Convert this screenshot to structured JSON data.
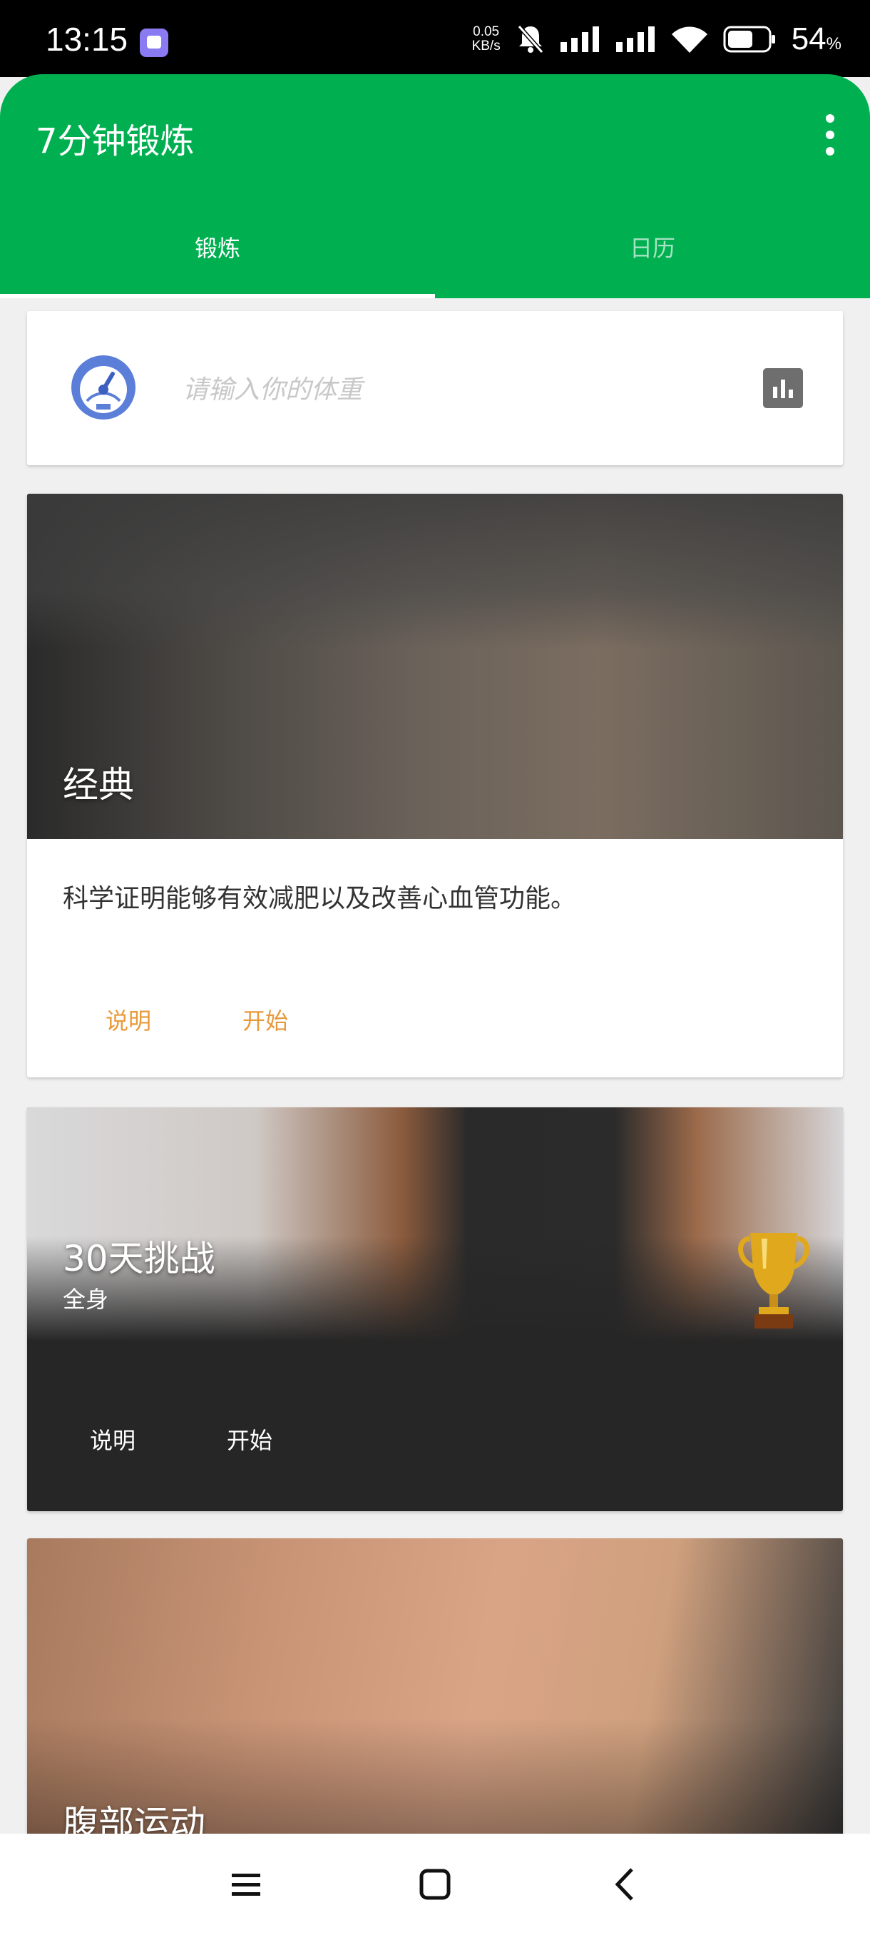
{
  "status_bar": {
    "time": "13:15",
    "net_speed_value": "0.05",
    "net_speed_unit": "KB/s",
    "battery_percent": "54",
    "battery_unit": "%",
    "icons": [
      "app-notification-icon",
      "mute-icon",
      "signal-icon",
      "signal-icon",
      "wifi-icon",
      "battery-icon"
    ]
  },
  "app_bar": {
    "title": "7分钟锻炼",
    "menu_icon": "overflow-menu-icon",
    "background_color": "#00b050"
  },
  "tabs": [
    {
      "label": "锻炼",
      "selected": true
    },
    {
      "label": "日历",
      "selected": false
    }
  ],
  "weight_card": {
    "icon": "gauge-icon",
    "input_placeholder": "请输入你的体重",
    "input_value": "",
    "stats_icon": "bar-chart-icon"
  },
  "workouts": [
    {
      "title": "经典",
      "description": "科学证明能够有效减肥以及改善心血管功能。",
      "buttons": {
        "info": "说明",
        "start": "开始"
      },
      "button_color": "#e8993a"
    },
    {
      "title": "30天挑战",
      "subtitle": "全身",
      "badge_icon": "trophy-icon",
      "buttons": {
        "info": "说明",
        "start": "开始"
      }
    },
    {
      "title": "腹部运动"
    }
  ],
  "nav_bar": {
    "icons": [
      "menu-icon",
      "home-icon",
      "back-icon"
    ]
  }
}
